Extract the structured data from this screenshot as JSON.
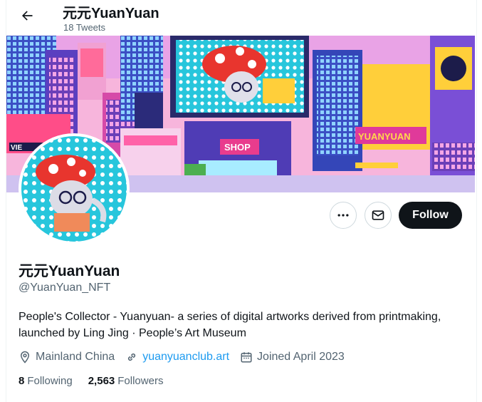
{
  "header": {
    "title": "元元YuanYuan",
    "tweet_count": "18 Tweets"
  },
  "banner": {
    "shop_sign": "SHOP",
    "store_sign": "YUANYUAN",
    "vie_sign": "VIE"
  },
  "profile": {
    "display_name": "元元YuanYuan",
    "handle": "@YuanYuan_NFT",
    "bio": "People's Collector - Yuanyuan- a series of digital artworks derived from printmaking, launched by Ling Jing · People’s Art Museum",
    "location": "Mainland China",
    "website": "yuanyuanclub.art",
    "joined": "Joined April 2023"
  },
  "actions": {
    "follow_label": "Follow"
  },
  "stats": {
    "following_count": "8",
    "following_label": "Following",
    "followers_count": "2,563",
    "followers_label": "Followers"
  },
  "colors": {
    "accent": "#1d9bf0",
    "follow_bg": "#0f1419",
    "muted_text": "#536471"
  }
}
